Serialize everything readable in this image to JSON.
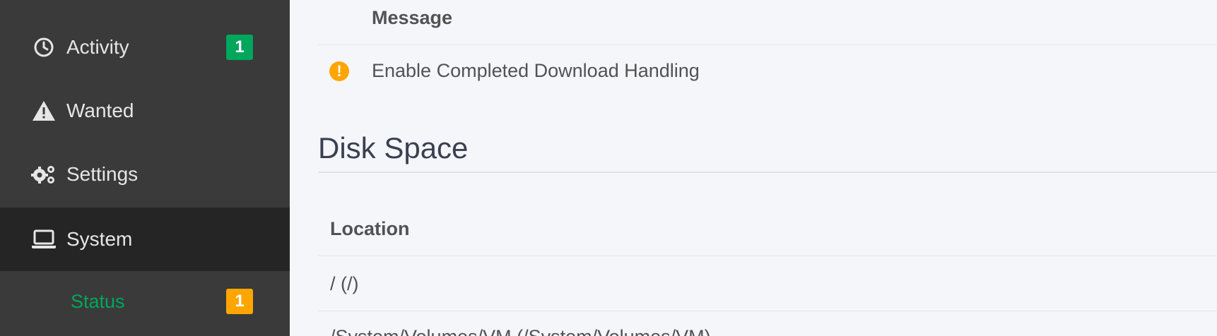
{
  "sidebar": {
    "items": [
      {
        "label": "Activity",
        "icon": "clock-icon",
        "badge": "1",
        "badge_color": "#00a65b"
      },
      {
        "label": "Wanted",
        "icon": "warning-icon"
      },
      {
        "label": "Settings",
        "icon": "gears-icon"
      },
      {
        "label": "System",
        "icon": "laptop-icon",
        "active": true
      }
    ],
    "sub_items": [
      {
        "label": "Status",
        "badge": "1",
        "badge_color": "#ffa500",
        "color": "#00a65b"
      }
    ]
  },
  "health": {
    "header_message": "Message",
    "rows": [
      {
        "icon": "warning-circle-icon",
        "icon_glyph": "!",
        "message": "Enable Completed Download Handling"
      }
    ]
  },
  "disk_space": {
    "title": "Disk Space",
    "header_location": "Location",
    "rows": [
      {
        "location": "/ (/)"
      },
      {
        "location": "/System/Volumes/VM (/System/Volumes/VM)"
      }
    ]
  },
  "colors": {
    "sidebar_bg": "#3a3a3a",
    "sidebar_active_bg": "#252525",
    "accent_green": "#00a65b",
    "warning_orange": "#ffa500",
    "main_bg": "#f5f6fa"
  }
}
